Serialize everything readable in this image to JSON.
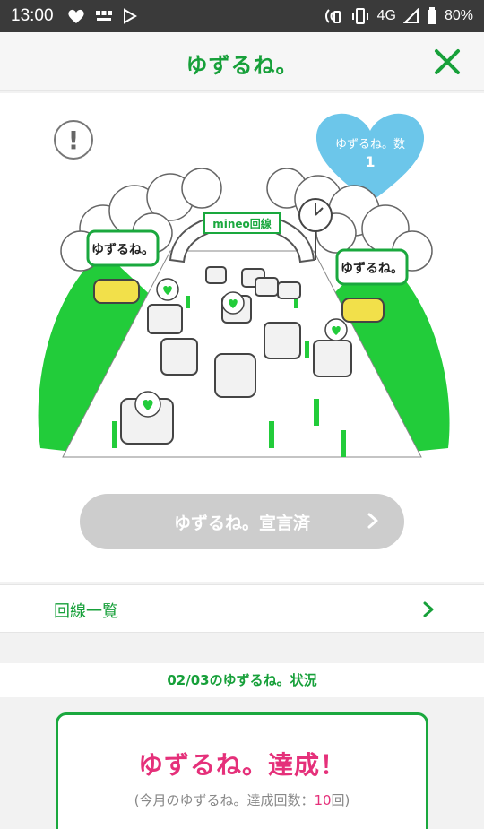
{
  "status_bar": {
    "time": "13:00",
    "network": "4G",
    "battery": "80%",
    "icons": [
      "heart-leaf-icon",
      "bbc-news-icon",
      "play-store-icon",
      "nfc-icon",
      "vibrate-icon",
      "signal-icon",
      "battery-icon"
    ]
  },
  "appbar": {
    "title": "ゆずるね。",
    "close_icon": "close-icon"
  },
  "hero": {
    "badge_label": "ゆずるね。数",
    "badge_count": "1",
    "info_symbol": "!",
    "sign_text": "mineo回線",
    "bubble_text": "ゆずるね。",
    "declare_button": "ゆずるね。宣言済"
  },
  "list": {
    "lines_label": "回線一覧"
  },
  "status": {
    "title": "02/03のゆずるね。状況",
    "result_main": "ゆずるね。達成！",
    "result_sub_prefix": "(今月のゆずるね。達成回数：",
    "result_sub_count": "10",
    "result_sub_suffix": "回)"
  },
  "colors": {
    "brand_green": "#17a03a",
    "heart_blue": "#6cc6ea",
    "accent_pink": "#e5307a",
    "disabled_button": "#cdcdcd"
  }
}
